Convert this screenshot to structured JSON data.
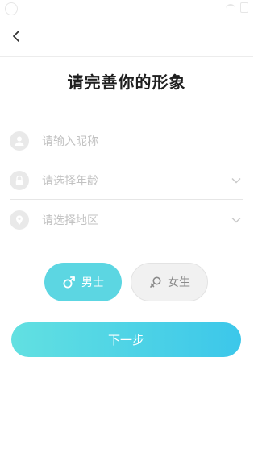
{
  "nav": {
    "back_icon": "chevron-left-icon"
  },
  "page": {
    "title": "请完善你的形象"
  },
  "form": {
    "nickname": {
      "placeholder": "请输入昵称",
      "icon": "user-icon"
    },
    "age": {
      "placeholder": "请选择年龄",
      "icon": "lock-icon"
    },
    "region": {
      "placeholder": "请选择地区",
      "icon": "location-pin-icon"
    }
  },
  "gender": {
    "male_label": "男士",
    "female_label": "女生",
    "selected": "male",
    "male_color": "#5cd6e2"
  },
  "actions": {
    "next_label": "下一步"
  },
  "colors": {
    "accent_start": "#62e0e1",
    "accent_end": "#3cc7ea",
    "placeholder": "#c2c2c2"
  }
}
